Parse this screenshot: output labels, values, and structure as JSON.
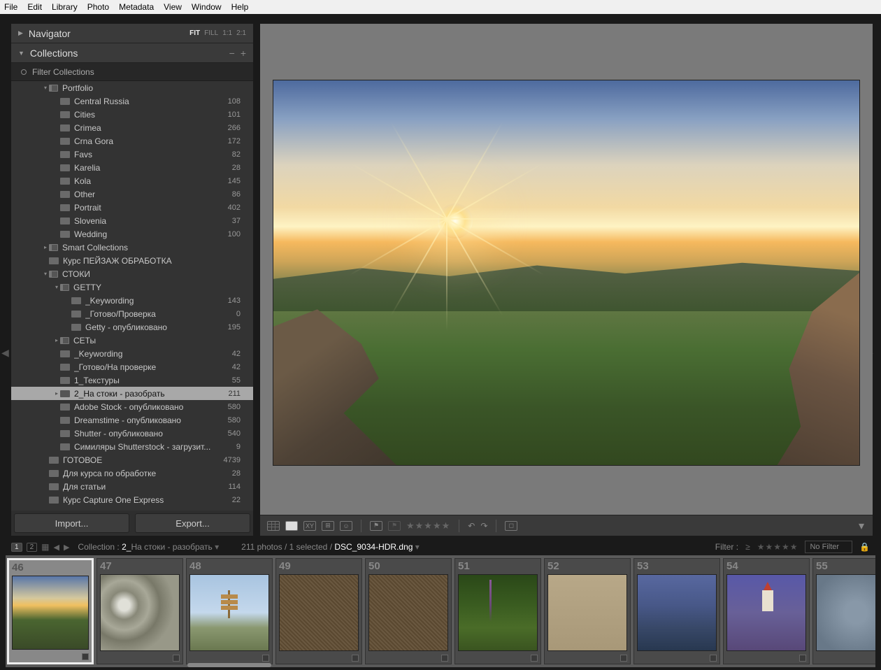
{
  "menu": [
    "File",
    "Edit",
    "Library",
    "Photo",
    "Metadata",
    "View",
    "Window",
    "Help"
  ],
  "navigator": {
    "title": "Navigator",
    "opts": [
      "FIT",
      "FILL",
      "1:1",
      "2:1"
    ],
    "active": 0
  },
  "collections": {
    "title": "Collections",
    "filter_label": "Filter Collections",
    "tree": [
      {
        "d": 0,
        "a": "▾",
        "i": "set",
        "l": "Portfolio",
        "c": ""
      },
      {
        "d": 1,
        "a": "",
        "i": "c",
        "l": "Central Russia",
        "c": "108"
      },
      {
        "d": 1,
        "a": "",
        "i": "c",
        "l": "Cities",
        "c": "101"
      },
      {
        "d": 1,
        "a": "",
        "i": "c",
        "l": "Crimea",
        "c": "266"
      },
      {
        "d": 1,
        "a": "",
        "i": "c",
        "l": "Crna Gora",
        "c": "172"
      },
      {
        "d": 1,
        "a": "",
        "i": "c",
        "l": "Favs",
        "c": "82"
      },
      {
        "d": 1,
        "a": "",
        "i": "c",
        "l": "Karelia",
        "c": "28"
      },
      {
        "d": 1,
        "a": "",
        "i": "c",
        "l": "Kola",
        "c": "145"
      },
      {
        "d": 1,
        "a": "",
        "i": "c",
        "l": "Other",
        "c": "86"
      },
      {
        "d": 1,
        "a": "",
        "i": "c",
        "l": "Portrait",
        "c": "402"
      },
      {
        "d": 1,
        "a": "",
        "i": "c",
        "l": "Slovenia",
        "c": "37"
      },
      {
        "d": 1,
        "a": "",
        "i": "c",
        "l": "Wedding",
        "c": "100"
      },
      {
        "d": 0,
        "a": "▸",
        "i": "set",
        "l": "Smart Collections",
        "c": ""
      },
      {
        "d": 0,
        "a": "",
        "i": "c",
        "l": "Курс ПЕЙЗАЖ ОБРАБОТКА",
        "c": ""
      },
      {
        "d": 0,
        "a": "▾",
        "i": "set",
        "l": "СТОКИ",
        "c": ""
      },
      {
        "d": 1,
        "a": "▾",
        "i": "set",
        "l": "GETTY",
        "c": ""
      },
      {
        "d": 2,
        "a": "",
        "i": "c",
        "l": "_Keywording",
        "c": "143"
      },
      {
        "d": 2,
        "a": "",
        "i": "c",
        "l": "_Готово/Проверка",
        "c": "0"
      },
      {
        "d": 2,
        "a": "",
        "i": "c",
        "l": "Getty - опубликовано",
        "c": "195"
      },
      {
        "d": 1,
        "a": "▸",
        "i": "set",
        "l": "СЕТы",
        "c": ""
      },
      {
        "d": 1,
        "a": "",
        "i": "c",
        "l": "_Keywording",
        "c": "42"
      },
      {
        "d": 1,
        "a": "",
        "i": "c",
        "l": "_Готово/На проверке",
        "c": "42"
      },
      {
        "d": 1,
        "a": "",
        "i": "c",
        "l": "1_Текстуры",
        "c": "55"
      },
      {
        "d": 1,
        "a": "▸",
        "i": "c",
        "l": "2_На стоки - разобрать",
        "c": "211",
        "sel": true
      },
      {
        "d": 1,
        "a": "",
        "i": "c",
        "l": "Adobe Stock - опубликовано",
        "c": "580"
      },
      {
        "d": 1,
        "a": "",
        "i": "c",
        "l": "Dreamstime - опубликовано",
        "c": "580"
      },
      {
        "d": 1,
        "a": "",
        "i": "c",
        "l": "Shutter - опубликовано",
        "c": "540"
      },
      {
        "d": 1,
        "a": "",
        "i": "c",
        "l": "Симиляры Shutterstock - загрузит...",
        "c": "9"
      },
      {
        "d": 0,
        "a": "",
        "i": "c",
        "l": "ГОТОВОЕ",
        "c": "4739"
      },
      {
        "d": 0,
        "a": "",
        "i": "c",
        "l": "Для курса по обработке",
        "c": "28"
      },
      {
        "d": 0,
        "a": "",
        "i": "c",
        "l": "Для статьи",
        "c": "114"
      },
      {
        "d": 0,
        "a": "",
        "i": "c",
        "l": "Курс Capture One Express",
        "c": "22"
      }
    ]
  },
  "buttons": {
    "import": "Import...",
    "export": "Export..."
  },
  "strip": {
    "crumb_prefix": "Collection :",
    "crumb_num": "2_",
    "crumb_name": "На стоки - разобрать",
    "meta_pre": "211 photos / 1 selected /",
    "meta_file": "DSC_9034-HDR.dng",
    "filter_label": "Filter :",
    "nofilter": "No Filter",
    "pages": [
      "1",
      "2"
    ]
  },
  "thumbs": [
    {
      "n": "46",
      "cls": "t46",
      "sel": true
    },
    {
      "n": "47",
      "cls": "t47"
    },
    {
      "n": "48",
      "cls": "t48",
      "extra": "signpost"
    },
    {
      "n": "49",
      "cls": "t49"
    },
    {
      "n": "50",
      "cls": "t50"
    },
    {
      "n": "51",
      "cls": "t51",
      "extra": "lavender"
    },
    {
      "n": "52",
      "cls": "t52"
    },
    {
      "n": "53",
      "cls": "t53"
    },
    {
      "n": "54",
      "cls": "t54",
      "extra": "church"
    },
    {
      "n": "55",
      "cls": "t55"
    }
  ]
}
